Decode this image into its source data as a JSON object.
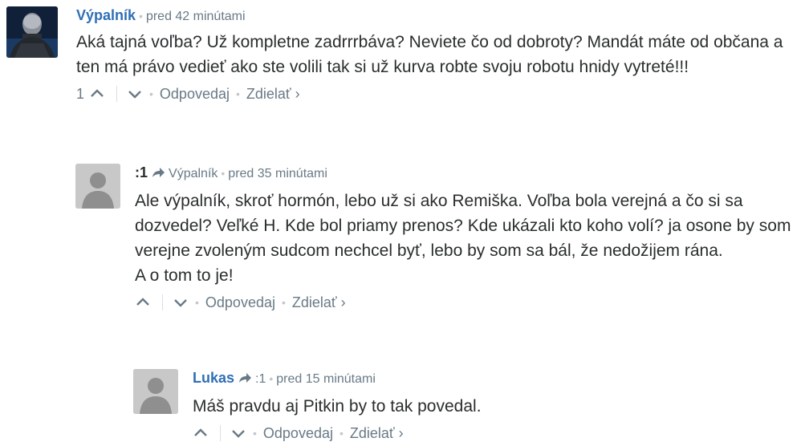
{
  "comments": [
    {
      "author": "Výpalník",
      "time": "pred 42 minútami",
      "message": [
        "Aká tajná voľba? Už kompletne zadrrrbáva? Neviete čo od dobroty? Mandát máte od občana a ten má právo vedieť ako ste volili tak si už kurva robte svoju robotu hnidy vytreté!!!"
      ],
      "votes": "1",
      "reply_label": "Odpovedaj",
      "share_label": "Zdielať ›"
    },
    {
      "author": ":1",
      "reply_to": "Výpalník",
      "time": "pred 35 minútami",
      "message": [
        "Ale výpalník, skroť hormón, lebo už si ako Remiška. Voľba bola verejná a čo si sa dozvedel? Veľké H. Kde bol priamy prenos? Kde ukázali kto koho volí? ja osone by som verejne zvoleným sudcom nechcel byť, lebo by som sa bál, že nedožijem rána.",
        "A o tom to je!"
      ],
      "votes": "",
      "reply_label": "Odpovedaj",
      "share_label": "Zdielať ›"
    },
    {
      "author": "Lukas",
      "reply_to": ":1",
      "time": "pred 15 minútami",
      "message": [
        "Máš pravdu aj Pitkin by to tak povedal."
      ],
      "votes": "",
      "reply_label": "Odpovedaj",
      "share_label": "Zdielať ›"
    }
  ],
  "colors": {
    "author_link": "#2e6fb5",
    "meta": "#687a86",
    "text": "#2a2e2e",
    "avatar_placeholder": "#c4c4c4"
  }
}
